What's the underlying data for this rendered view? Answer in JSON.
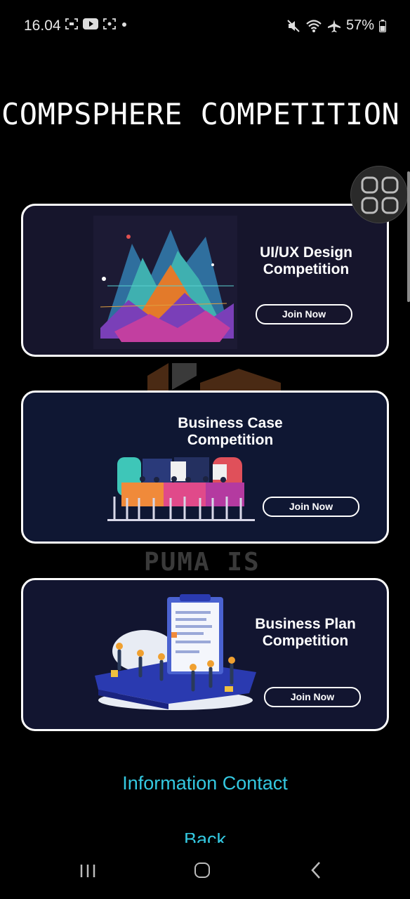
{
  "status_bar": {
    "time": "16.04",
    "battery": "57%"
  },
  "page": {
    "title": "COMPSPHERE COMPETITION"
  },
  "cards": [
    {
      "title": "UI/UX Design Competition",
      "button": "Join Now"
    },
    {
      "title": "Business Case Competition",
      "button": "Join Now"
    },
    {
      "title": "Business Plan Competition",
      "button": "Join Now"
    }
  ],
  "watermark": "PUMA IS",
  "links": {
    "info_contact": "Information Contact",
    "back": "Back"
  },
  "colors": {
    "link": "#34c8e0",
    "background": "#000000",
    "card_border": "#ffffff"
  }
}
